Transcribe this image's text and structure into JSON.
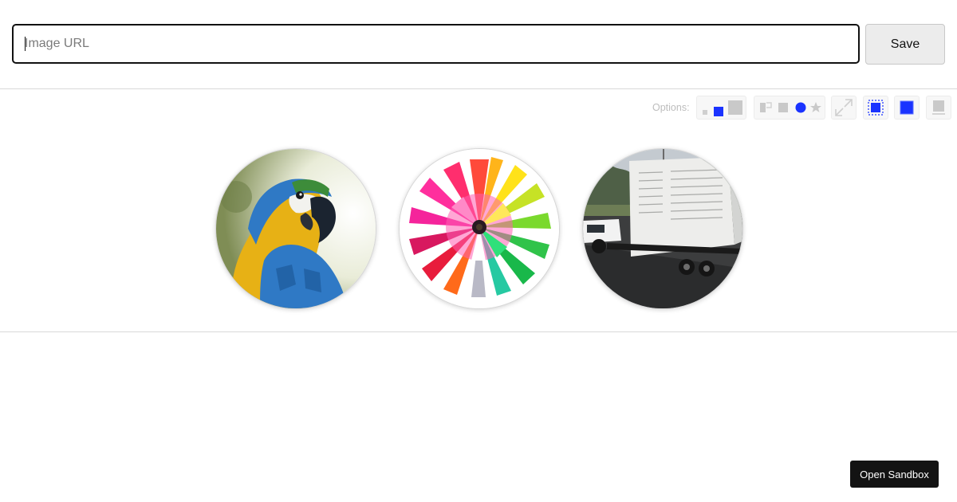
{
  "url_input": {
    "placeholder": "Image URL",
    "value": ""
  },
  "save_button": {
    "label": "Save"
  },
  "options": {
    "label": "Options:",
    "groups": [
      "size-options",
      "shape-options",
      "zoom-option",
      "selected-option",
      "active-option",
      "disabled-option"
    ],
    "active_color": "#1a33ff",
    "inactive_color": "#c8c8c8"
  },
  "images": [
    {
      "subject": "parrot-photo"
    },
    {
      "subject": "flower-photo"
    },
    {
      "subject": "trailer-photo"
    }
  ],
  "sandbox_button": {
    "label": "Open Sandbox"
  }
}
